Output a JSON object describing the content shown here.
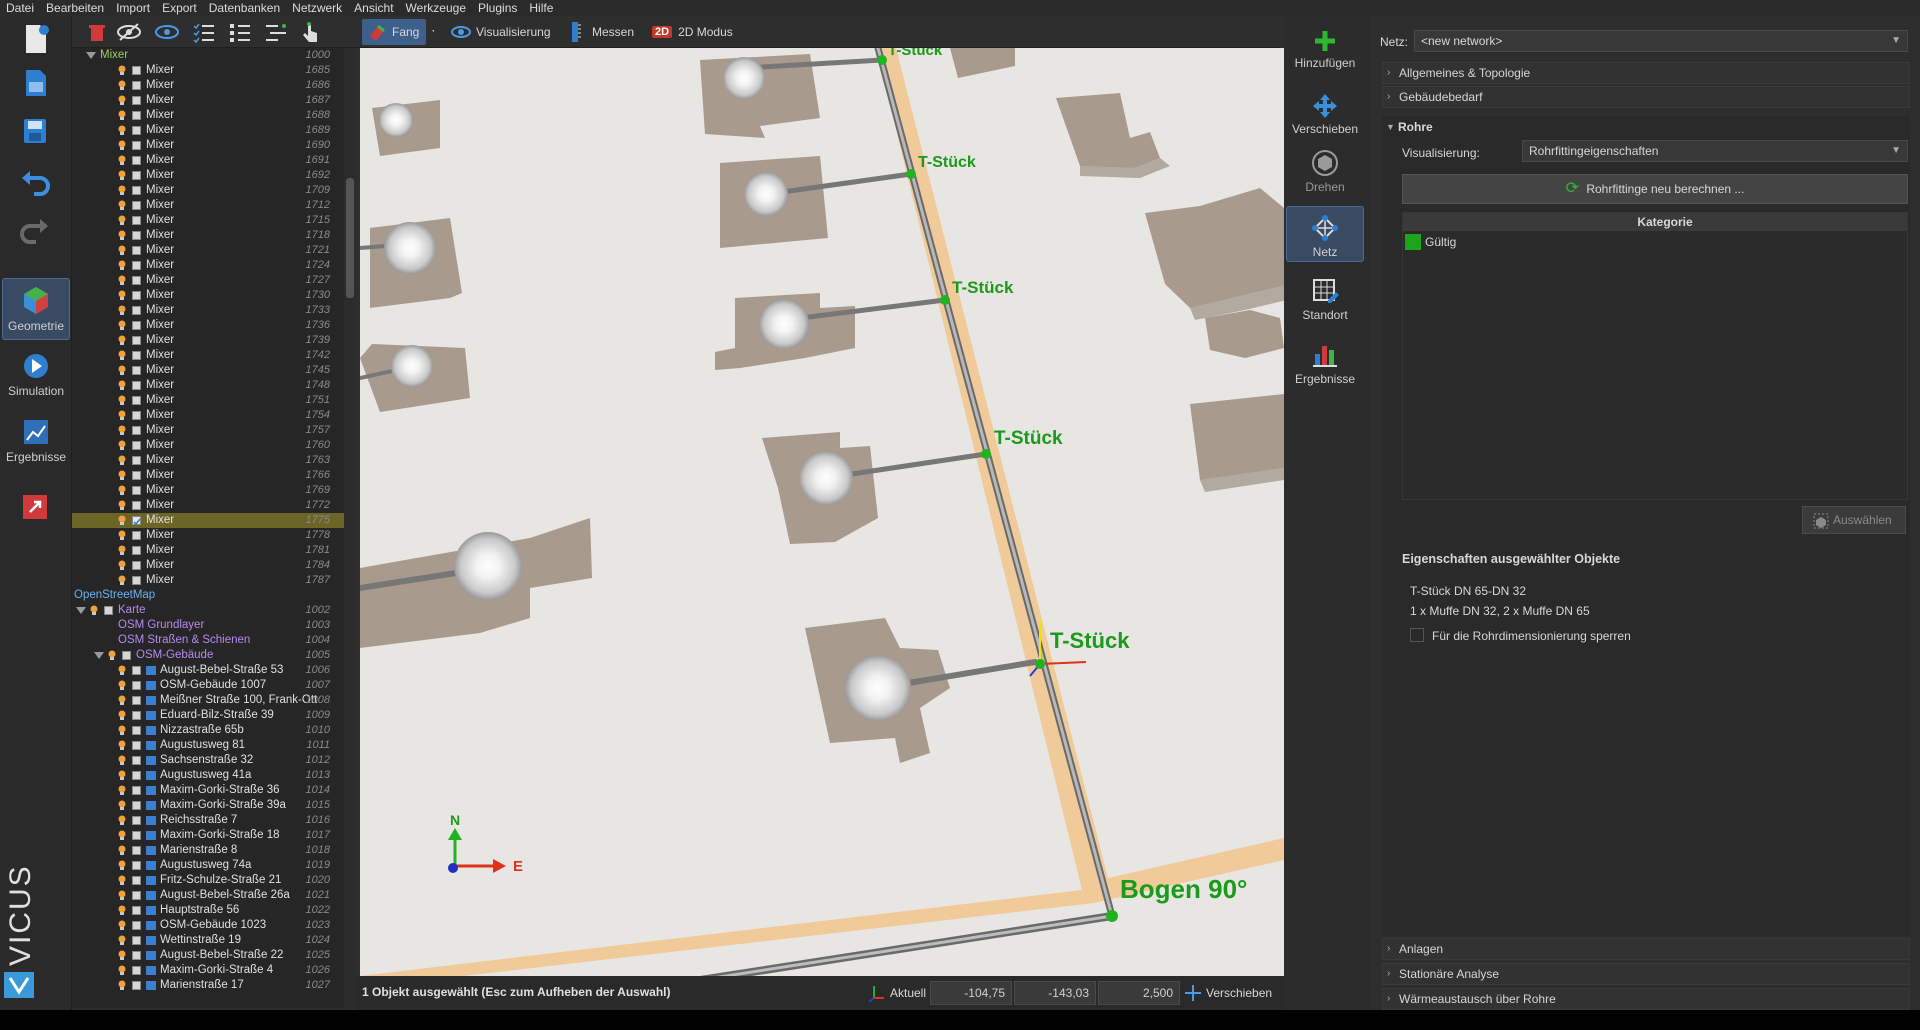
{
  "menu": [
    "Datei",
    "Bearbeiten",
    "Import",
    "Export",
    "Datenbanken",
    "Netzwerk",
    "Ansicht",
    "Werkzeuge",
    "Plugins",
    "Hilfe"
  ],
  "left_modes": {
    "geometry": "Geometrie",
    "simulation": "Simulation",
    "results": "Ergebnisse"
  },
  "brand": "VICUS",
  "toolbar": {
    "snap": "Fang",
    "visualization": "Visualisierung",
    "measure": "Messen",
    "mode2d_badge": "2D",
    "mode2d": "2D Modus"
  },
  "tree": {
    "mixer_group": {
      "name": "Mixer",
      "id": "1000"
    },
    "mixers": [
      {
        "name": "Mixer",
        "id": "1685"
      },
      {
        "name": "Mixer",
        "id": "1686"
      },
      {
        "name": "Mixer",
        "id": "1687"
      },
      {
        "name": "Mixer",
        "id": "1688"
      },
      {
        "name": "Mixer",
        "id": "1689"
      },
      {
        "name": "Mixer",
        "id": "1690"
      },
      {
        "name": "Mixer",
        "id": "1691"
      },
      {
        "name": "Mixer",
        "id": "1692"
      },
      {
        "name": "Mixer",
        "id": "1709"
      },
      {
        "name": "Mixer",
        "id": "1712"
      },
      {
        "name": "Mixer",
        "id": "1715"
      },
      {
        "name": "Mixer",
        "id": "1718"
      },
      {
        "name": "Mixer",
        "id": "1721"
      },
      {
        "name": "Mixer",
        "id": "1724"
      },
      {
        "name": "Mixer",
        "id": "1727"
      },
      {
        "name": "Mixer",
        "id": "1730"
      },
      {
        "name": "Mixer",
        "id": "1733"
      },
      {
        "name": "Mixer",
        "id": "1736"
      },
      {
        "name": "Mixer",
        "id": "1739"
      },
      {
        "name": "Mixer",
        "id": "1742"
      },
      {
        "name": "Mixer",
        "id": "1745"
      },
      {
        "name": "Mixer",
        "id": "1748"
      },
      {
        "name": "Mixer",
        "id": "1751"
      },
      {
        "name": "Mixer",
        "id": "1754"
      },
      {
        "name": "Mixer",
        "id": "1757"
      },
      {
        "name": "Mixer",
        "id": "1760"
      },
      {
        "name": "Mixer",
        "id": "1763"
      },
      {
        "name": "Mixer",
        "id": "1766"
      },
      {
        "name": "Mixer",
        "id": "1769"
      },
      {
        "name": "Mixer",
        "id": "1772"
      },
      {
        "name": "Mixer",
        "id": "1775",
        "selected": true
      },
      {
        "name": "Mixer",
        "id": "1778"
      },
      {
        "name": "Mixer",
        "id": "1781"
      },
      {
        "name": "Mixer",
        "id": "1784"
      },
      {
        "name": "Mixer",
        "id": "1787"
      }
    ],
    "osm": {
      "name": "OpenStreetMap",
      "karte": {
        "name": "Karte",
        "id": "1002"
      },
      "grundlayer": {
        "name": "OSM Grundlayer",
        "id": "1003"
      },
      "strassen": {
        "name": "OSM Straßen & Schienen",
        "id": "1004"
      },
      "gebaeude": {
        "name": "OSM-Gebäude",
        "id": "1005"
      }
    },
    "buildings": [
      {
        "name": "August-Bebel-Straße 53",
        "id": "1006"
      },
      {
        "name": "OSM-Gebäude 1007",
        "id": "1007"
      },
      {
        "name": "Meißner Straße 100, Frank-Ott",
        "id": "1008"
      },
      {
        "name": "Eduard-Bilz-Straße 39",
        "id": "1009"
      },
      {
        "name": "Nizzastraße 65b",
        "id": "1010"
      },
      {
        "name": "Augustusweg 81",
        "id": "1011"
      },
      {
        "name": "Sachsenstraße 32",
        "id": "1012"
      },
      {
        "name": "Augustusweg 41a",
        "id": "1013"
      },
      {
        "name": "Maxim-Gorki-Straße 36",
        "id": "1014"
      },
      {
        "name": "Maxim-Gorki-Straße 39a",
        "id": "1015"
      },
      {
        "name": "Reichsstraße 7",
        "id": "1016"
      },
      {
        "name": "Maxim-Gorki-Straße 18",
        "id": "1017"
      },
      {
        "name": "Marienstraße 8",
        "id": "1018"
      },
      {
        "name": "Augustusweg 74a",
        "id": "1019"
      },
      {
        "name": "Fritz-Schulze-Straße 21",
        "id": "1020"
      },
      {
        "name": "August-Bebel-Straße 26a",
        "id": "1021"
      },
      {
        "name": "Hauptstraße 56",
        "id": "1022"
      },
      {
        "name": "OSM-Gebäude 1023",
        "id": "1023"
      },
      {
        "name": "Wettinstraße 19",
        "id": "1024"
      },
      {
        "name": "August-Bebel-Straße 22",
        "id": "1025"
      },
      {
        "name": "Maxim-Gorki-Straße 4",
        "id": "1026"
      },
      {
        "name": "Marienstraße 17",
        "id": "1027"
      }
    ]
  },
  "viewport": {
    "labels": [
      "T-Stück",
      "T-Stück",
      "T-Stück",
      "T-Stück",
      "T-Stück",
      "Bogen 90°"
    ],
    "axis_n": "N",
    "axis_e": "E"
  },
  "status": {
    "message": "1 Objekt ausgewählt (Esc zum Aufheben der Auswahl)",
    "coord_label": "Aktuell",
    "x": "-104,75",
    "y": "-143,03",
    "z": "2,500",
    "move": "Verschieben"
  },
  "vtools": {
    "add": "Hinzufügen",
    "move": "Verschieben",
    "rotate": "Drehen",
    "network": "Netz",
    "location": "Standort",
    "results": "Ergebnisse"
  },
  "right": {
    "net_label": "Netz:",
    "net_value": "<new network>",
    "sections": [
      "Allgemeines & Topologie",
      "Gebäudebedarf"
    ],
    "rohre": "Rohre",
    "vis_label": "Visualisierung:",
    "vis_value": "Rohrfittingeigenschaften",
    "recalc": "Rohrfittinge neu berechnen ...",
    "table_header": "Kategorie",
    "category": "Gültig",
    "category_color": "#1aa51a",
    "select": "Auswählen",
    "props_title": "Eigenschaften ausgewählter Objekte",
    "prop1": "T-Stück DN 65-DN 32",
    "prop2": "1 x Muffe DN 32, 2 x Muffe DN 65",
    "lock": "Für die Rohrdimensionierung sperren",
    "bottom_sections": [
      "Anlagen",
      "Stationäre Analyse",
      "Wärmeaustausch über Rohre"
    ]
  }
}
